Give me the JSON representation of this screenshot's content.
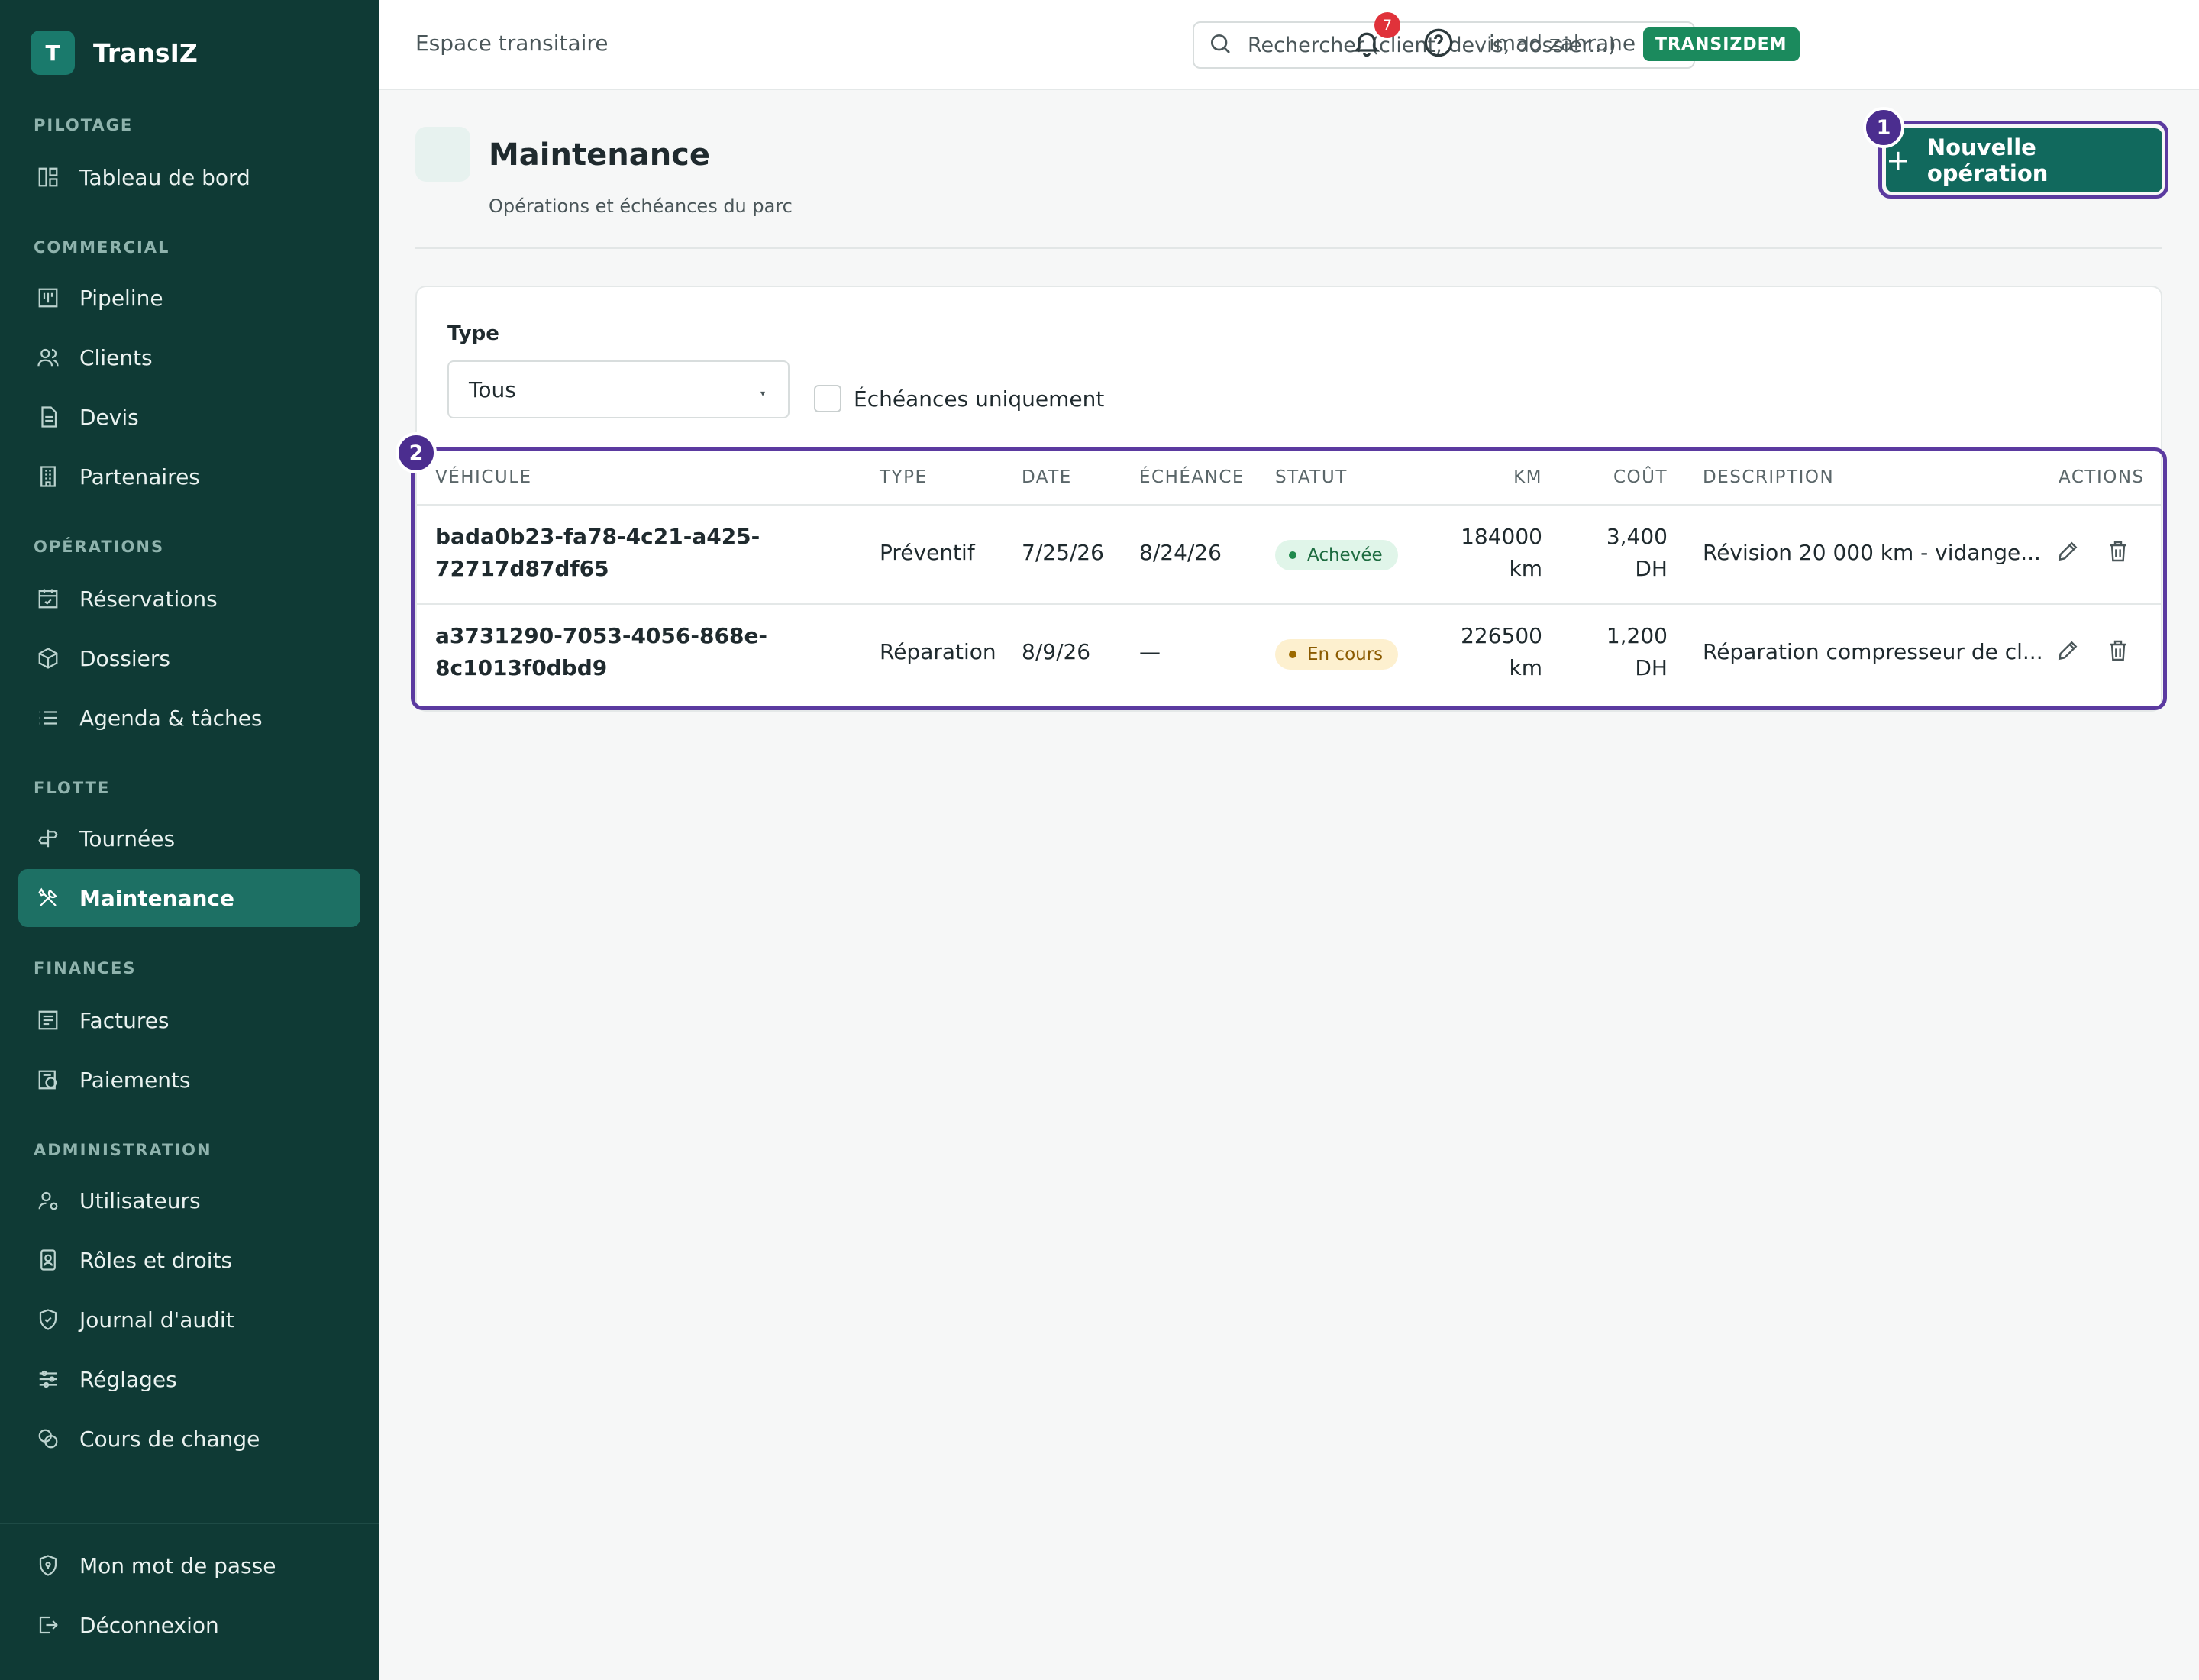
{
  "brand": {
    "logo_letter": "T",
    "name": "TransIZ"
  },
  "sidebar": {
    "sections": [
      {
        "label": "PILOTAGE"
      },
      {
        "label": "COMMERCIAL"
      },
      {
        "label": "OPÉRATIONS"
      },
      {
        "label": "FLOTTE"
      },
      {
        "label": "FINANCES"
      },
      {
        "label": "ADMINISTRATION"
      }
    ],
    "items": [
      {
        "label": "Tableau de bord",
        "icon": "dashboard-icon"
      },
      {
        "label": "Pipeline",
        "icon": "kanban-icon"
      },
      {
        "label": "Clients",
        "icon": "users-icon"
      },
      {
        "label": "Devis",
        "icon": "document-icon"
      },
      {
        "label": "Partenaires",
        "icon": "building-icon"
      },
      {
        "label": "Réservations",
        "icon": "calendar-check-icon"
      },
      {
        "label": "Dossiers",
        "icon": "package-icon"
      },
      {
        "label": "Agenda & tâches",
        "icon": "list-icon"
      },
      {
        "label": "Tournées",
        "icon": "signpost-icon"
      },
      {
        "label": "Maintenance",
        "icon": "tools-icon",
        "active": true
      },
      {
        "label": "Factures",
        "icon": "invoice-icon"
      },
      {
        "label": "Paiements",
        "icon": "payment-icon"
      },
      {
        "label": "Utilisateurs",
        "icon": "user-cog-icon"
      },
      {
        "label": "Rôles et droits",
        "icon": "id-badge-icon"
      },
      {
        "label": "Journal d'audit",
        "icon": "shield-icon"
      },
      {
        "label": "Réglages",
        "icon": "sliders-icon"
      },
      {
        "label": "Cours de change",
        "icon": "coins-icon"
      }
    ],
    "footer": [
      {
        "label": "Mon mot de passe",
        "icon": "shield-lock-icon"
      },
      {
        "label": "Déconnexion",
        "icon": "logout-icon"
      }
    ]
  },
  "topbar": {
    "title": "Espace transitaire",
    "search_placeholder": "Rechercher (client, devis, dossier...)",
    "notification_count": "7",
    "user_name": "imad zahrane",
    "tenant": "TRANSIZDEM"
  },
  "page": {
    "title": "Maintenance",
    "subtitle": "Opérations et échéances du parc",
    "new_button": "Nouvelle opération",
    "markers": [
      "1",
      "2"
    ]
  },
  "filters": {
    "type_label": "Type",
    "type_value": "Tous",
    "due_only_label": "Échéances uniquement"
  },
  "table": {
    "headers": [
      "VÉHICULE",
      "TYPE",
      "DATE",
      "ÉCHÉANCE",
      "STATUT",
      "KM",
      "COÛT",
      "DESCRIPTION",
      "ACTIONS"
    ],
    "rows": [
      {
        "vehicle_line1": "bada0b23-fa78-4c21-a425-",
        "vehicle_line2": "72717d87df65",
        "type": "Préventif",
        "date": "7/25/26",
        "due": "8/24/26",
        "status": "Achevée",
        "km_line1": "184000",
        "km_line2": "km",
        "cost_line1": "3,400",
        "cost_line2": "DH",
        "description": "Révision 20 000 km - vidange..."
      },
      {
        "vehicle_line1": "a3731290-7053-4056-868e-",
        "vehicle_line2": "8c1013f0dbd9",
        "type": "Réparation",
        "date": "8/9/26",
        "due": "—",
        "status": "En cours",
        "km_line1": "226500",
        "km_line2": "km",
        "cost_line1": "1,200",
        "cost_line2": "DH",
        "description": "Réparation compresseur de cl..."
      }
    ]
  },
  "colors": {
    "sidebar_bg": "#0f3a35",
    "accent": "#11695d",
    "highlight": "#5b3aa0",
    "badge_red": "#e0323a",
    "tenant_green": "#1b8a5d"
  }
}
